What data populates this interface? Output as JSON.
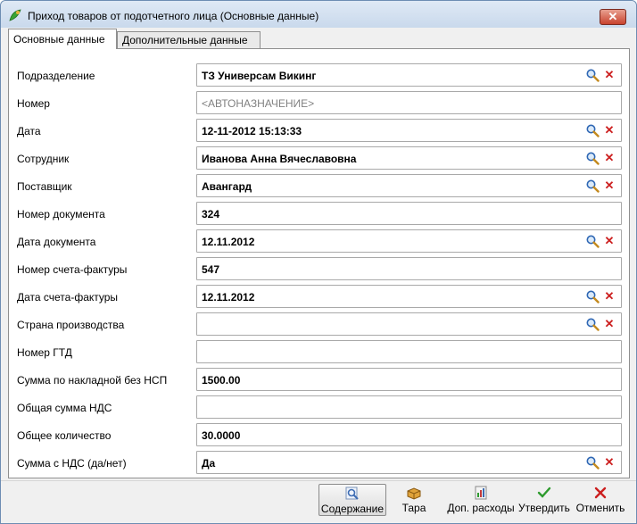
{
  "window": {
    "title": "Приход товаров от подотчетного лица (Основные данные)",
    "close_glyph": "✕"
  },
  "tabs": [
    {
      "label": "Основные данные",
      "active": true
    },
    {
      "label": "Дополнительные данные",
      "active": false
    }
  ],
  "fields": [
    {
      "label": "Подразделение",
      "value": "ТЗ Универсам Викинг",
      "lookup": true
    },
    {
      "label": "Номер",
      "value": "<АВТОНАЗНАЧЕНИЕ>",
      "lookup": false,
      "placeholder": true
    },
    {
      "label": "Дата",
      "value": "12-11-2012 15:13:33",
      "lookup": true
    },
    {
      "label": "Сотрудник",
      "value": "Иванова Анна Вячеславовна",
      "lookup": true
    },
    {
      "label": "Поставщик",
      "value": "Авангард",
      "lookup": true
    },
    {
      "label": "Номер документа",
      "value": "324",
      "lookup": false
    },
    {
      "label": "Дата документа",
      "value": "12.11.2012",
      "lookup": true
    },
    {
      "label": "Номер счета-фактуры",
      "value": "547",
      "lookup": false
    },
    {
      "label": "Дата счета-фактуры",
      "value": "12.11.2012",
      "lookup": true
    },
    {
      "label": "Страна производства",
      "value": "",
      "lookup": true
    },
    {
      "label": "Номер ГТД",
      "value": "",
      "lookup": false
    },
    {
      "label": "Сумма по накладной без НСП",
      "value": "1500.00",
      "lookup": false
    },
    {
      "label": "Общая сумма НДС",
      "value": "",
      "lookup": false
    },
    {
      "label": "Общее количество",
      "value": "30.0000",
      "lookup": false
    },
    {
      "label": "Сумма с НДС (да/нет)",
      "value": "Да",
      "lookup": true
    }
  ],
  "icons": {
    "lookup": "magnifier-icon",
    "clear": "red-x-icon",
    "clear_glyph": "✕"
  },
  "toolbar": {
    "content_label": "Содержание",
    "tara_label": "Тара",
    "extra_costs_label": "Доп. расходы",
    "approve_label": "Утвердить",
    "cancel_label": "Отменить"
  },
  "colors": {
    "accent_green": "#2e9b2e",
    "clear_red": "#cc1f1f",
    "title_bar": "#c9d9ec"
  }
}
